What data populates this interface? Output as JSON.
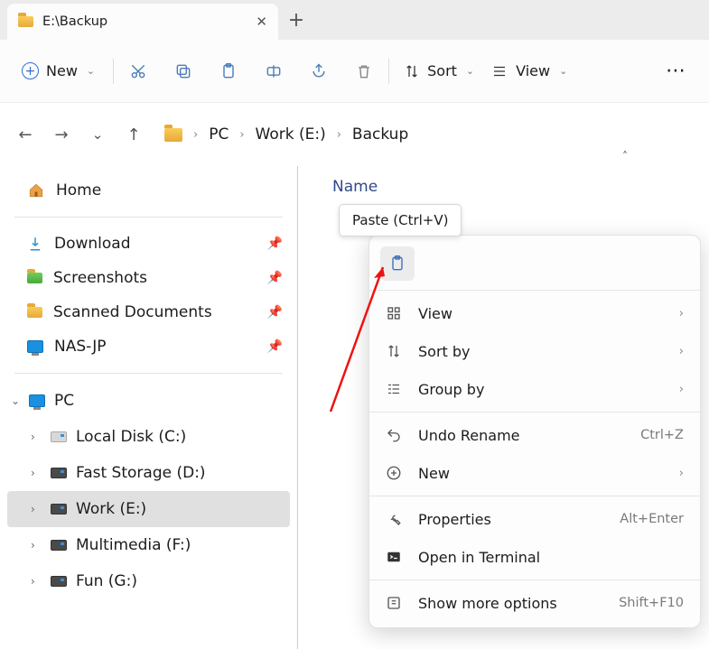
{
  "tab": {
    "title": "E:\\Backup"
  },
  "toolbar": {
    "new_label": "New",
    "sort_label": "Sort",
    "view_label": "View"
  },
  "breadcrumb": {
    "seg1": "PC",
    "seg2": "Work (E:)",
    "seg3": "Backup"
  },
  "sidebar": {
    "home": "Home",
    "quick": [
      {
        "label": "Download"
      },
      {
        "label": "Screenshots"
      },
      {
        "label": "Scanned Documents"
      },
      {
        "label": "NAS-JP"
      }
    ],
    "pc_label": "PC",
    "drives": [
      {
        "label": "Local Disk (C:)"
      },
      {
        "label": "Fast Storage (D:)"
      },
      {
        "label": "Work (E:)",
        "selected": true
      },
      {
        "label": "Multimedia (F:)"
      },
      {
        "label": "Fun (G:)"
      }
    ]
  },
  "content": {
    "column_name": "Name"
  },
  "tooltip": {
    "text": "Paste (Ctrl+V)"
  },
  "context_menu": {
    "view": "View",
    "sort_by": "Sort by",
    "group_by": "Group by",
    "undo": "Undo Rename",
    "undo_kbd": "Ctrl+Z",
    "new": "New",
    "properties": "Properties",
    "properties_kbd": "Alt+Enter",
    "terminal": "Open in Terminal",
    "more": "Show more options",
    "more_kbd": "Shift+F10"
  }
}
